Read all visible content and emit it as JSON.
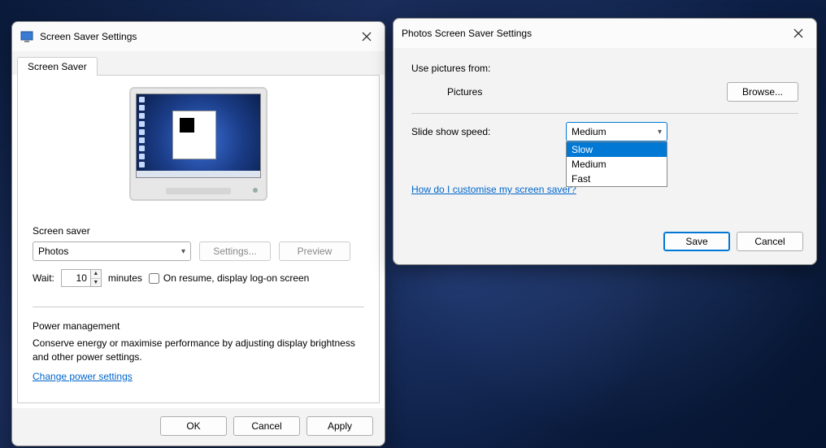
{
  "dlg1": {
    "title": "Screen Saver Settings",
    "tab": "Screen Saver",
    "section_screen_saver": "Screen saver",
    "screensaver_selected": "Photos",
    "btn_settings": "Settings...",
    "btn_preview": "Preview",
    "wait_label": "Wait:",
    "wait_value": "10",
    "wait_minutes": "minutes",
    "resume_label": "On resume, display log-on screen",
    "power_heading": "Power management",
    "power_desc": "Conserve energy or maximise performance by adjusting display brightness and other power settings.",
    "power_link": "Change power settings",
    "btn_ok": "OK",
    "btn_cancel": "Cancel",
    "btn_apply": "Apply"
  },
  "dlg2": {
    "title": "Photos Screen Saver Settings",
    "use_pictures_label": "Use pictures from:",
    "pictures_value": "Pictures",
    "browse_btn": "Browse...",
    "speed_label": "Slide show speed:",
    "speed_selected": "Medium",
    "speed_options": {
      "slow": "Slow",
      "medium": "Medium",
      "fast": "Fast"
    },
    "help_link": "How do I customise my screen saver?",
    "btn_save": "Save",
    "btn_cancel": "Cancel"
  }
}
